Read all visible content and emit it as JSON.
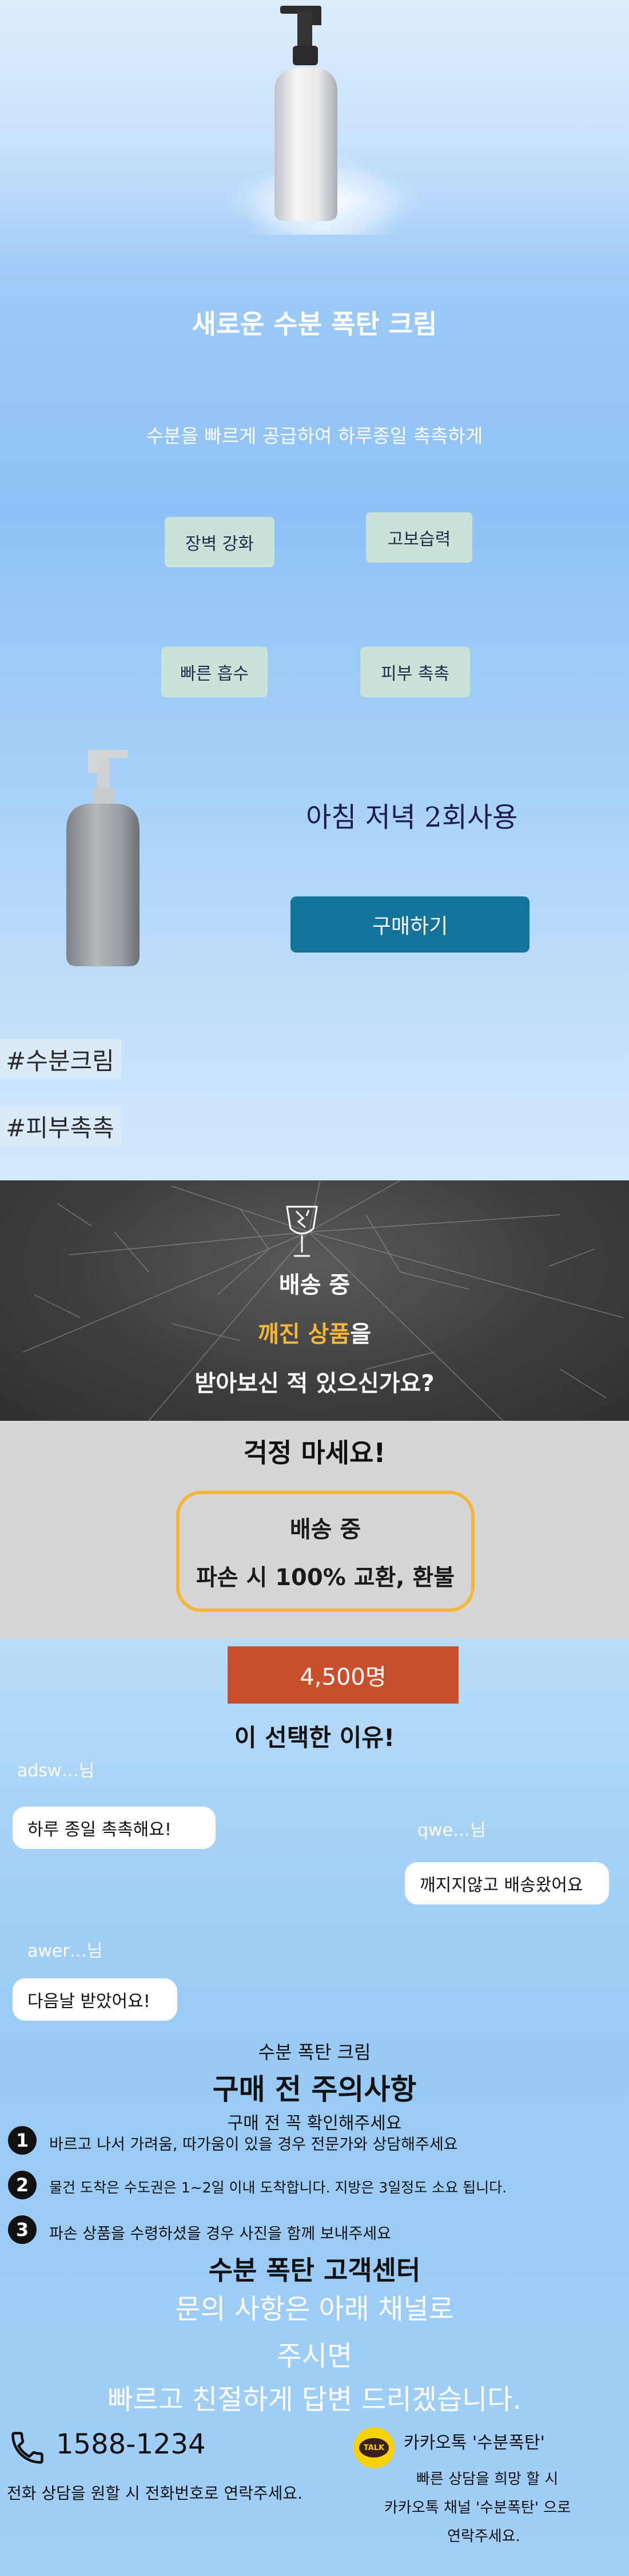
{
  "hero": {
    "title": "새로운 수분 폭탄 크림",
    "subtitle": "수분을 빠르게 공급하여 하루종일 촉촉하게",
    "features": [
      "장벽 강화",
      "고보습력",
      "빠른 흡수",
      "피부 촉촉"
    ],
    "usage": "아침 저녁 2회사용",
    "buy_label": "구매하기",
    "tags": [
      "#수분크림",
      "#피부촉촉"
    ]
  },
  "delivery": {
    "line1": "배송 중",
    "line2_highlight": "깨진 상품",
    "line2_rest": "을",
    "line3": "받아보신 적 있으신가요?",
    "reassure": "걱정 마세요!",
    "box_line1": "배송 중",
    "box_line2": "파손 시 100% 교환, 환불"
  },
  "reviews": {
    "count": "4,500명",
    "heading": "이 선택한 이유!",
    "items": [
      {
        "user": "adsw…님",
        "text": "하루 종일 촉촉해요!"
      },
      {
        "user": "qwe…님",
        "text": "깨지지않고 배송왔어요"
      },
      {
        "user": "awer…님",
        "text": "다음날 받았어요!"
      }
    ]
  },
  "notice": {
    "product": "수분 폭탄 크림",
    "title": "구매 전 주의사항",
    "subtitle": "구매 전 꼭 확인해주세요",
    "items": [
      {
        "num": "1",
        "text": "바르고 나서 가려움, 따가움이 있을 경우 전문가와 상담해주세요"
      },
      {
        "num": "2",
        "text": "물건 도착은 수도권은 1~2일 이내 도착합니다. 지방은 3일정도 소요 됩니다."
      },
      {
        "num": "3",
        "text": "파손 상품을 수령하셨을 경우 사진을 함께 보내주세요"
      }
    ],
    "cs_title": "수분 폭탄 고객센터",
    "cs_line1": "문의 사항은 아래 채널로",
    "cs_line2": "주시면",
    "cs_line3": "빠르고 친절하게 답변 드리겠습니다."
  },
  "contact": {
    "phone": "1588-1234",
    "phone_desc": "전화 상담을 원할 시 전화번호로 연락주세요.",
    "kakao_badge": "TALK",
    "kakao_title": "카카오톡 '수분폭탄'",
    "kakao_desc1": "빠른 상담을 희망 할 시",
    "kakao_desc2": "카카오톡 채널 '수분폭탄' 으로",
    "kakao_desc3": "연락주세요."
  },
  "colors": {
    "buy_button": "#137399",
    "feature_chip": "#c9e3d8",
    "highlight_yellow": "#f4b63a",
    "count_badge": "#c8502a"
  }
}
